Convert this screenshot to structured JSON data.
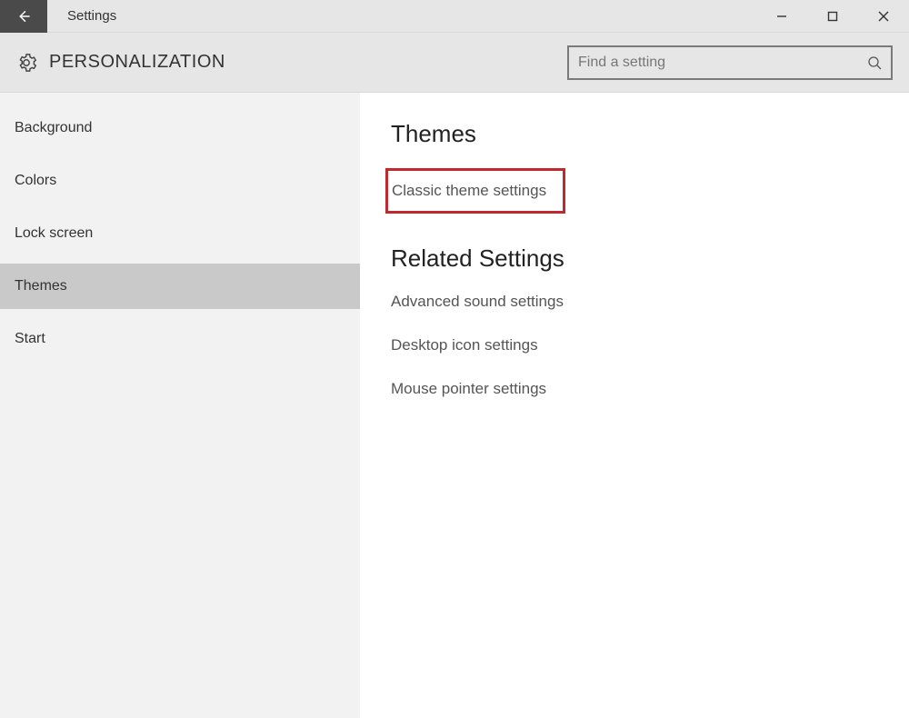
{
  "titlebar": {
    "title": "Settings"
  },
  "header": {
    "category": "PERSONALIZATION",
    "search_placeholder": "Find a setting"
  },
  "sidebar": {
    "items": [
      {
        "label": "Background",
        "selected": false
      },
      {
        "label": "Colors",
        "selected": false
      },
      {
        "label": "Lock screen",
        "selected": false
      },
      {
        "label": "Themes",
        "selected": true
      },
      {
        "label": "Start",
        "selected": false
      }
    ]
  },
  "content": {
    "themes_heading": "Themes",
    "classic_link": "Classic theme settings",
    "related_heading": "Related Settings",
    "related_links": [
      "Advanced sound settings",
      "Desktop icon settings",
      "Mouse pointer settings"
    ]
  }
}
